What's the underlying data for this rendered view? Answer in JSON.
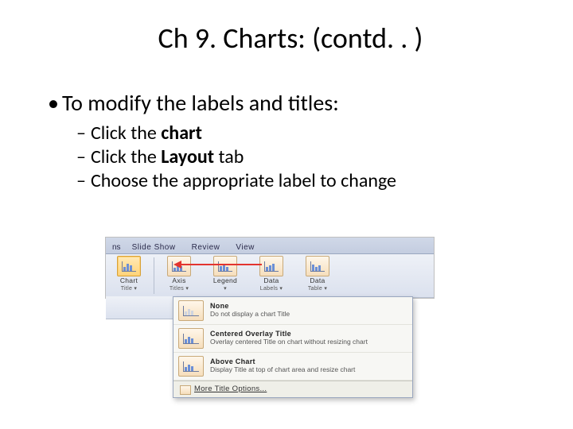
{
  "title": "Ch 9. Charts: (contd. . )",
  "bullet": "To modify the labels and titles:",
  "sub": [
    {
      "pre": "Click the ",
      "bold": "chart",
      "post": ""
    },
    {
      "pre": "Click the ",
      "bold": "Layout",
      "post": " tab"
    },
    {
      "pre": "Choose the appropriate label to change",
      "bold": "",
      "post": ""
    }
  ],
  "ribbon": {
    "tabs": {
      "frag": "ns",
      "t1": "Slide Show",
      "t2": "Review",
      "t3": "View"
    },
    "groups": [
      {
        "l1": "Chart",
        "l2": "Title ▾"
      },
      {
        "l1": "Axis",
        "l2": "Titles ▾"
      },
      {
        "l1": "Legend",
        "l2": "▾"
      },
      {
        "l1": "Data",
        "l2": "Labels ▾"
      },
      {
        "l1": "Data",
        "l2": "Table ▾"
      }
    ],
    "menu": [
      {
        "h": "None",
        "d": "Do not display a chart Title"
      },
      {
        "h": "Centered Overlay Title",
        "d": "Overlay centered Title on chart without resizing chart"
      },
      {
        "h": "Above Chart",
        "d": "Display Title at top of chart area and resize chart"
      }
    ],
    "more": "More Title Options..."
  }
}
